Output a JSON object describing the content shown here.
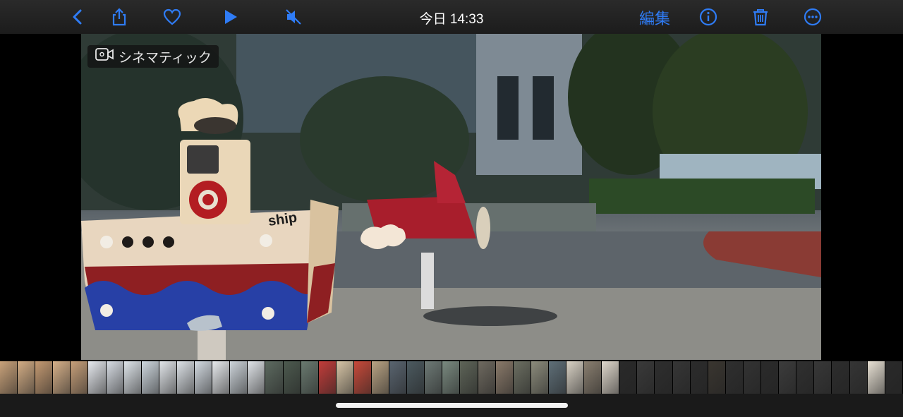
{
  "toolbar": {
    "title": "今日 14:33",
    "edit_label": "編集",
    "accent_color": "#2f7cf6",
    "icons": [
      "back-chevron-icon",
      "share-icon",
      "heart-icon",
      "play-icon",
      "mute-icon",
      "info-icon",
      "trash-icon",
      "more-icon"
    ]
  },
  "photo": {
    "badge_label": "シネマティック",
    "badge_icon": "cinematic-camera-icon",
    "toy_text": "ship"
  },
  "filmstrip": {
    "thumbnails": [
      {
        "color": "#c9a27a"
      },
      {
        "color": "#d3ad85"
      },
      {
        "color": "#c49a72"
      },
      {
        "color": "#d6b089"
      },
      {
        "color": "#c7a07a"
      },
      {
        "color": "#e6e9ee"
      },
      {
        "color": "#d8dde4"
      },
      {
        "color": "#dfe5ea"
      },
      {
        "color": "#cfd8df"
      },
      {
        "color": "#e2e6ea"
      },
      {
        "color": "#dde2e7"
      },
      {
        "color": "#d4dbe2"
      },
      {
        "color": "#e8ebee"
      },
      {
        "color": "#cdd4da"
      },
      {
        "color": "#e0e4e8"
      },
      {
        "color": "#5d6a60"
      },
      {
        "color": "#4d5a4f"
      },
      {
        "color": "#6a7a70"
      },
      {
        "color": "#c23d3a"
      },
      {
        "color": "#d7c5a6"
      },
      {
        "color": "#c84a3a"
      },
      {
        "color": "#b9a384"
      },
      {
        "color": "#5a6570"
      },
      {
        "color": "#4c5a60"
      },
      {
        "color": "#6e7a76"
      },
      {
        "color": "#7a8a80"
      },
      {
        "color": "#5e6458"
      },
      {
        "color": "#6f6a60"
      },
      {
        "color": "#8a7a6a"
      },
      {
        "color": "#6c6f62"
      },
      {
        "color": "#8c8c7c"
      },
      {
        "color": "#5f6f78"
      },
      {
        "color": "#d9d2c5"
      },
      {
        "color": "#8a7f70"
      },
      {
        "color": "#e0d8cc"
      },
      {
        "color": "#2a2a2a"
      },
      {
        "color": "#3a3a3a"
      },
      {
        "color": "#2e2e2e"
      },
      {
        "color": "#363636"
      },
      {
        "color": "#2c2c2c"
      },
      {
        "color": "#3a3630"
      },
      {
        "color": "#2f2f2f"
      },
      {
        "color": "#333333"
      },
      {
        "color": "#2b2b2b"
      },
      {
        "color": "#3c3c3c"
      },
      {
        "color": "#303030"
      },
      {
        "color": "#383838"
      },
      {
        "color": "#2d2d2d"
      },
      {
        "color": "#353535"
      },
      {
        "color": "#e8e1d4"
      },
      {
        "color": "#2a2a2a"
      }
    ]
  }
}
